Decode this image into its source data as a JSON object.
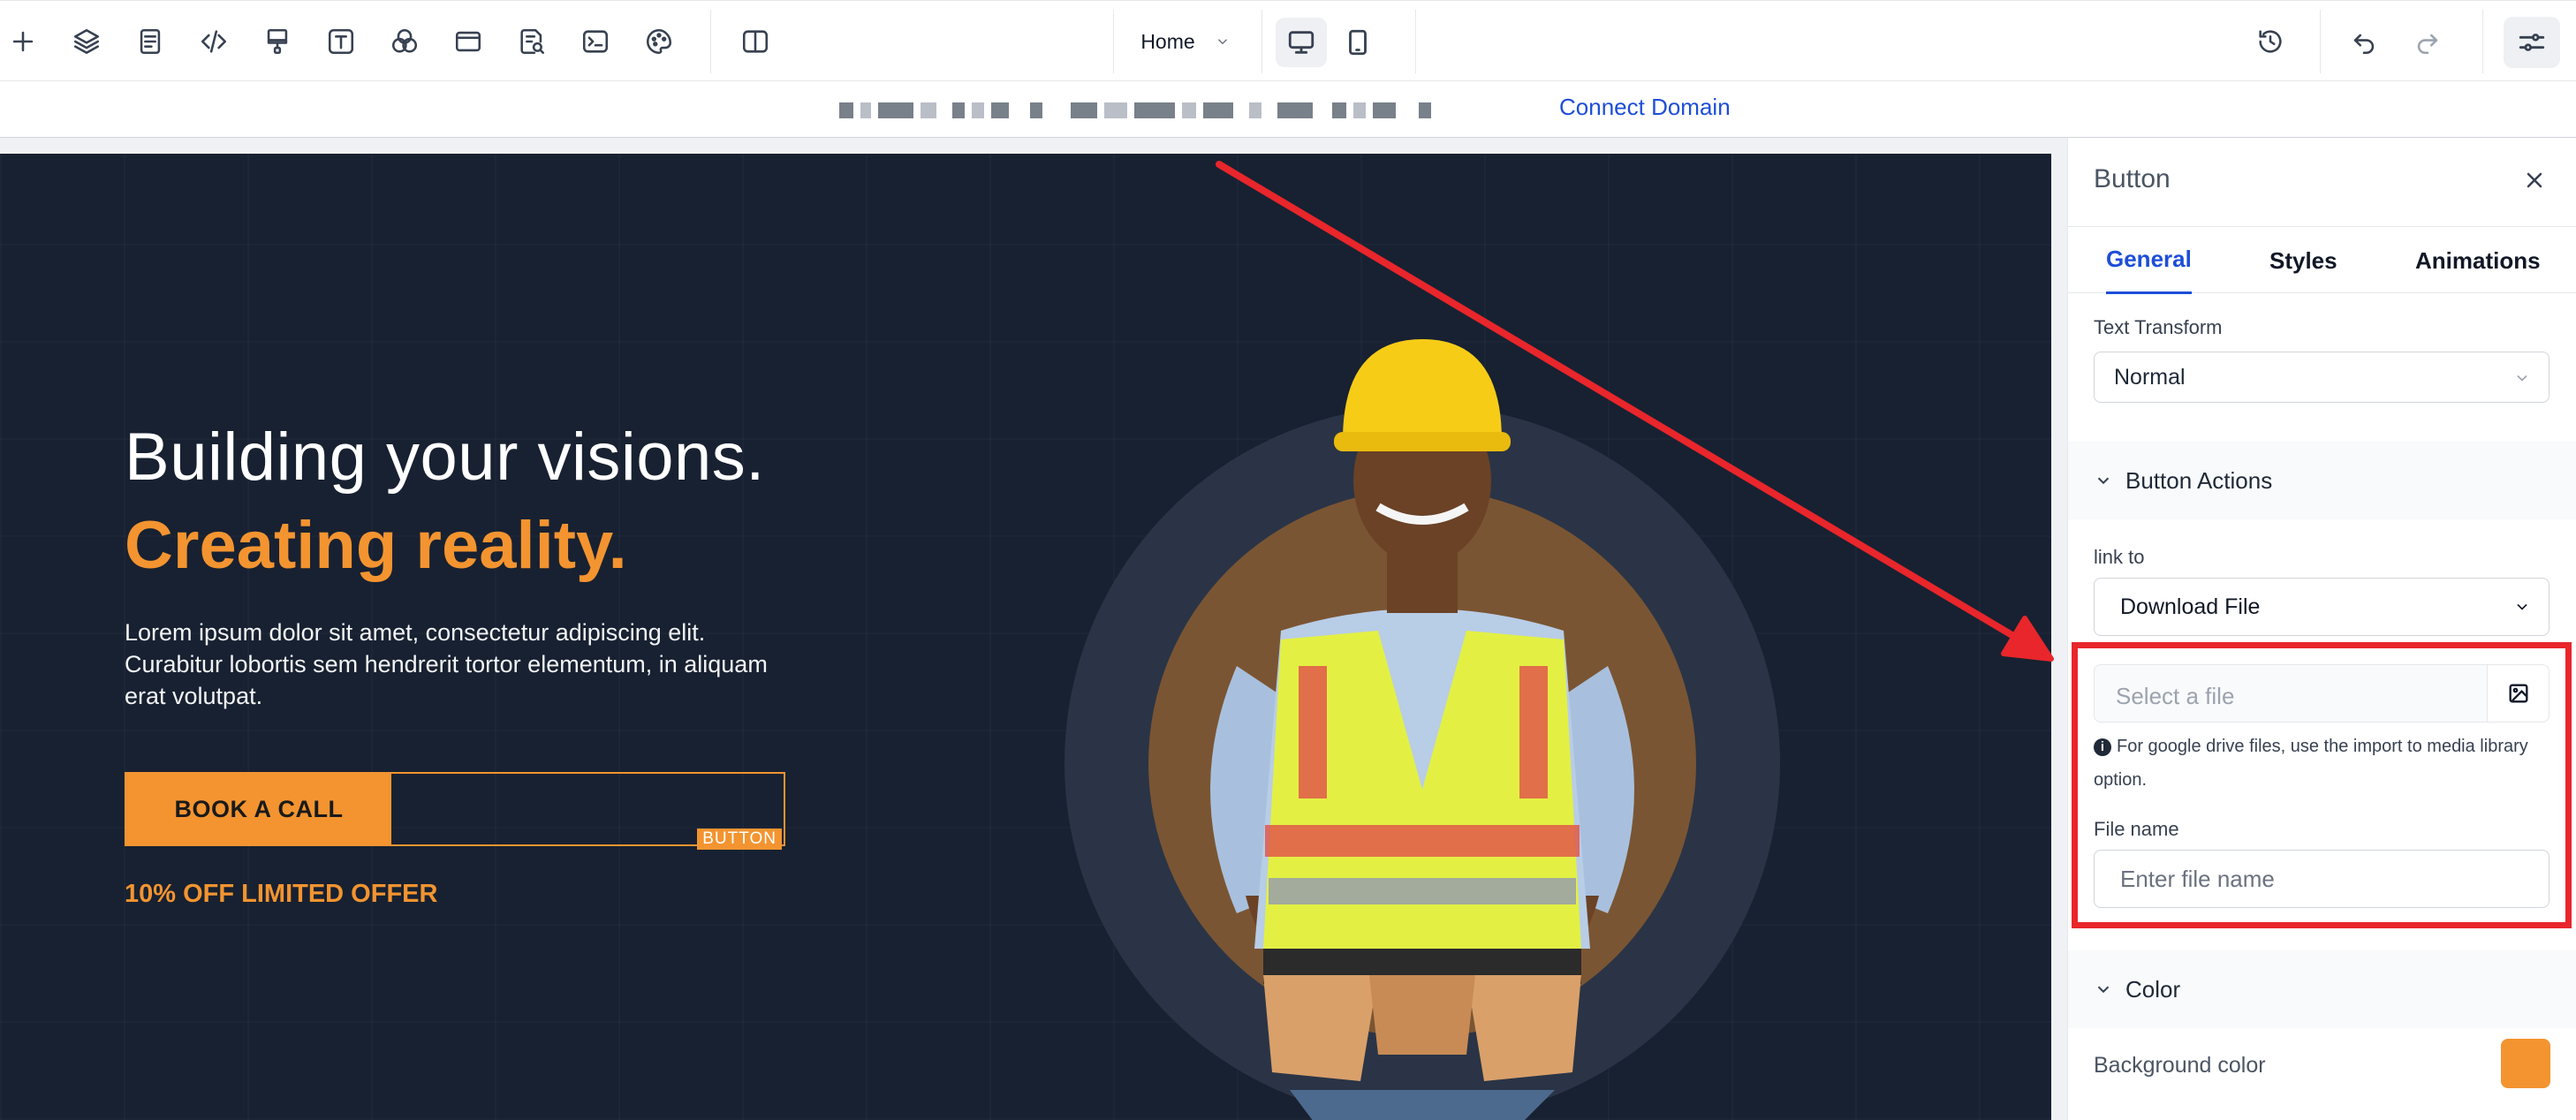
{
  "toolbar": {
    "left_icons": [
      "add-icon",
      "layers-icon",
      "pages-icon",
      "code-icon",
      "paint-icon",
      "text-icon",
      "color-circles-icon",
      "section-icon",
      "search-doc-icon",
      "terminal-icon",
      "palette-icon",
      "split-view-icon"
    ],
    "page_selector": {
      "value": "Home"
    },
    "devices": [
      "desktop-icon",
      "mobile-icon"
    ],
    "right_icons": [
      "history-icon",
      "undo-icon",
      "redo-icon",
      "settings-sliders-icon"
    ]
  },
  "urlbar": {
    "connect_domain_label": "Connect Domain"
  },
  "hero": {
    "title_line1": "Building your visions.",
    "title_line2": "Creating reality.",
    "body": "Lorem ipsum dolor sit amet, consectetur adipiscing elit. Curabitur lobortis sem hendrerit tortor elementum, in aliquam erat volutpat.",
    "cta_label": "BOOK A CALL",
    "selected_tag": "BUTTON",
    "offer": "10% OFF LIMITED OFFER",
    "colors": {
      "background": "#182131",
      "accent": "#f39430"
    }
  },
  "panel": {
    "title": "Button",
    "tabs": [
      {
        "label": "General",
        "active": true
      },
      {
        "label": "Styles",
        "active": false
      },
      {
        "label": "Animations",
        "active": false
      }
    ],
    "text_transform": {
      "label": "Text Transform",
      "value": "Normal"
    },
    "button_actions": {
      "heading": "Button Actions",
      "link_to_label": "link to",
      "link_to_value": "Download File",
      "file_placeholder": "Select a file",
      "hint": "For google drive files, use the import to media library option.",
      "file_name_label": "File name",
      "file_name_placeholder": "Enter file name"
    },
    "color": {
      "heading": "Color",
      "background_label": "Background color",
      "background_value": "#f39430"
    }
  }
}
